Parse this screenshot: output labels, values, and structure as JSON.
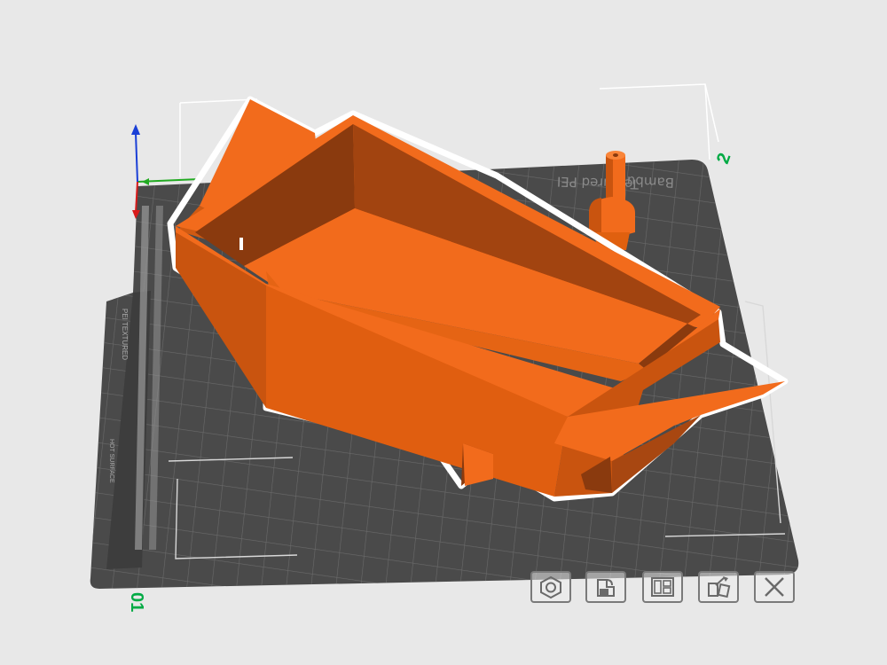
{
  "viewport": {
    "bed_label": "Textured PEI",
    "bed_label_prefix": "Bambu",
    "bed_side_label": "PEI TEXTURED",
    "bed_side_sub": "HOT SURFACE",
    "bed_corner_left": "01",
    "bed_corner_right": "2"
  },
  "colors": {
    "background": "#e8e8e8",
    "bed": "#4a4a4a",
    "grid": "#6e6e6e",
    "model": "#f26b1c",
    "model_dark": "#8a3a0e",
    "model_mid": "#c9540f",
    "selection_outline": "#ffffff",
    "axis_x": "#22aa22",
    "axis_y": "#1a3fd6",
    "axis_z": "#d81a1a",
    "label_green": "#00aa44"
  },
  "toolbar": {
    "buttons": [
      {
        "icon": "nut-icon"
      },
      {
        "icon": "lock-icon"
      },
      {
        "icon": "layout-icon"
      },
      {
        "icon": "paint-icon"
      },
      {
        "icon": "close-icon"
      }
    ]
  }
}
